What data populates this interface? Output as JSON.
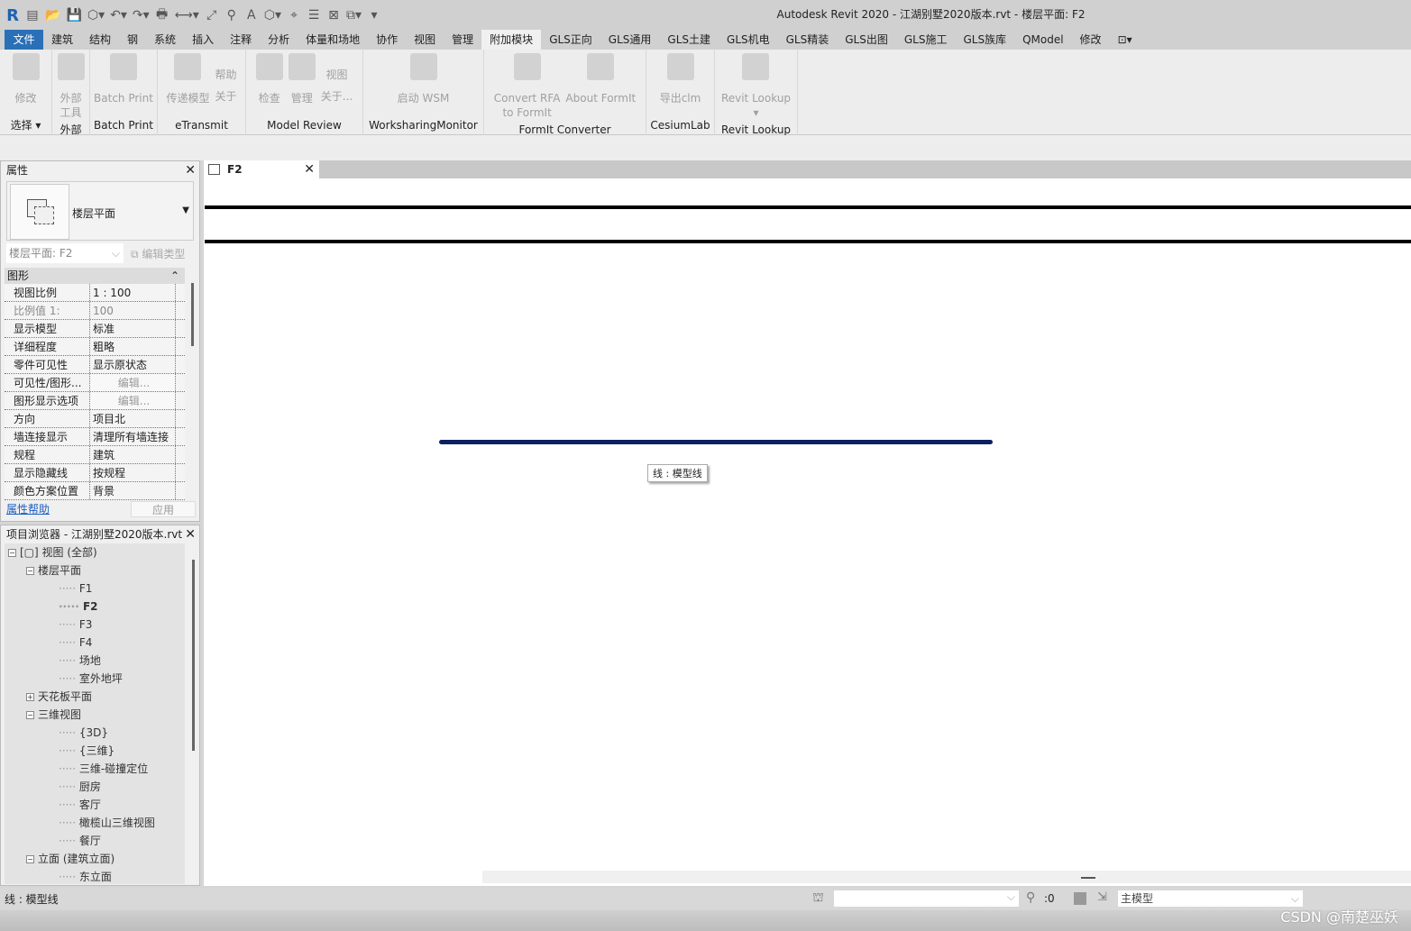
{
  "window": {
    "title": "Autodesk Revit 2020 - 江湖别墅2020版本.rvt - 楼层平面: F2"
  },
  "qat": [
    "R",
    "▤",
    "📂",
    "💾",
    "⬡▾",
    "↶▾",
    "↷▾",
    "🖶",
    "⟷▾",
    "⤢",
    "⚲",
    "A",
    "⬡▾",
    "⌖",
    "☰",
    "⊠",
    "⧉▾",
    "▾"
  ],
  "tabs": [
    "文件",
    "建筑",
    "结构",
    "钢",
    "系统",
    "插入",
    "注释",
    "分析",
    "体量和场地",
    "协作",
    "视图",
    "管理",
    "附加模块",
    "GLS正向",
    "GLS通用",
    "GLS土建",
    "GLS机电",
    "GLS精装",
    "GLS出图",
    "GLS施工",
    "GLS族库",
    "QModel",
    "修改",
    "⊡▾"
  ],
  "active_tab": "附加模块",
  "ribbon": [
    {
      "label": "选择 ▾",
      "width": 58,
      "buttons": [
        {
          "label": "修改",
          "icon": "cursor-icon"
        }
      ]
    },
    {
      "label": "外部",
      "width": 42,
      "buttons": [
        {
          "label": "外部\n工具",
          "icon": "tools-icon"
        }
      ]
    },
    {
      "label": "Batch Print",
      "width": 75,
      "buttons": [
        {
          "label": "Batch Print",
          "icon": "printer-icon"
        }
      ]
    },
    {
      "label": "eTransmit",
      "width": 98,
      "buttons": [
        {
          "label": "传递模型",
          "icon": "floppy-globe-icon"
        },
        {
          "label": "帮助\n关于",
          "icon": "none"
        }
      ]
    },
    {
      "label": "Model Review",
      "width": 130,
      "buttons": [
        {
          "label": "检查",
          "icon": "check-icon"
        },
        {
          "label": "管理",
          "icon": "manage-icon"
        },
        {
          "label": "视图\n关于...",
          "icon": "none"
        }
      ]
    },
    {
      "label": "WorksharingMonitor",
      "width": 134,
      "buttons": [
        {
          "label": "启动 WSM",
          "icon": "wsm-icon"
        }
      ]
    },
    {
      "label": "FormIt Converter",
      "width": 180,
      "buttons": [
        {
          "label": "Convert RFA\nto FormIt",
          "icon": "rfa-icon"
        },
        {
          "label": "About FormIt",
          "icon": "formit-icon"
        }
      ]
    },
    {
      "label": "CesiumLab",
      "width": 76,
      "buttons": [
        {
          "label": "导出clm",
          "icon": "cesiumlab-icon"
        }
      ]
    },
    {
      "label": "Revit Lookup",
      "width": 92,
      "buttons": [
        {
          "label": "Revit Lookup\n▾",
          "icon": "lookup-icon"
        }
      ]
    }
  ],
  "properties": {
    "title": "属性",
    "type_name": "楼层平面",
    "instance": "楼层平面: F2",
    "edit_type": "编辑类型",
    "group": "图形",
    "rows": [
      {
        "k": "视图比例",
        "v": " 1 : 100"
      },
      {
        "k": "比例值 1:",
        "v": "100",
        "dim": true
      },
      {
        "k": "显示模型",
        "v": "标准"
      },
      {
        "k": "详细程度",
        "v": "粗略"
      },
      {
        "k": "零件可见性",
        "v": "显示原状态"
      },
      {
        "k": "可见性/图形...",
        "v": "编辑...",
        "button": true
      },
      {
        "k": "图形显示选项",
        "v": "编辑...",
        "button": true
      },
      {
        "k": "方向",
        "v": "项目北"
      },
      {
        "k": "墙连接显示",
        "v": "清理所有墙连接"
      },
      {
        "k": "规程",
        "v": "建筑"
      },
      {
        "k": "显示隐藏线",
        "v": "按规程"
      },
      {
        "k": "颜色方案位置",
        "v": "背景"
      }
    ],
    "help": "属性帮助",
    "apply": "应用"
  },
  "browser": {
    "title": "项目浏览器 - 江湖别墅2020版本.rvt",
    "items": [
      {
        "t": "视图 (全部)",
        "l": 0,
        "tg": "−"
      },
      {
        "t": "楼层平面",
        "l": 1,
        "tg": "−"
      },
      {
        "t": "F1",
        "l": 2
      },
      {
        "t": "F2",
        "l": 2,
        "bold": true
      },
      {
        "t": "F3",
        "l": 2
      },
      {
        "t": "F4",
        "l": 2
      },
      {
        "t": "场地",
        "l": 2
      },
      {
        "t": "室外地坪",
        "l": 2
      },
      {
        "t": "天花板平面",
        "l": 1,
        "tg": "+"
      },
      {
        "t": "三维视图",
        "l": 1,
        "tg": "−"
      },
      {
        "t": "{3D}",
        "l": 2
      },
      {
        "t": "{三维}",
        "l": 2
      },
      {
        "t": "三维-碰撞定位",
        "l": 2
      },
      {
        "t": "厨房",
        "l": 2
      },
      {
        "t": "客厅",
        "l": 2
      },
      {
        "t": "橄榄山三维视图",
        "l": 2
      },
      {
        "t": "餐厅",
        "l": 2
      },
      {
        "t": "立面 (建筑立面)",
        "l": 1,
        "tg": "−"
      },
      {
        "t": "东立面",
        "l": 2
      }
    ]
  },
  "view": {
    "tab": "F2",
    "tooltip": "线 : 模型线",
    "line_color": "#0b2060"
  },
  "status": {
    "text": "线 : 模型线",
    "count": ":0",
    "model": "主模型"
  },
  "watermark": "CSDN @南楚巫妖"
}
